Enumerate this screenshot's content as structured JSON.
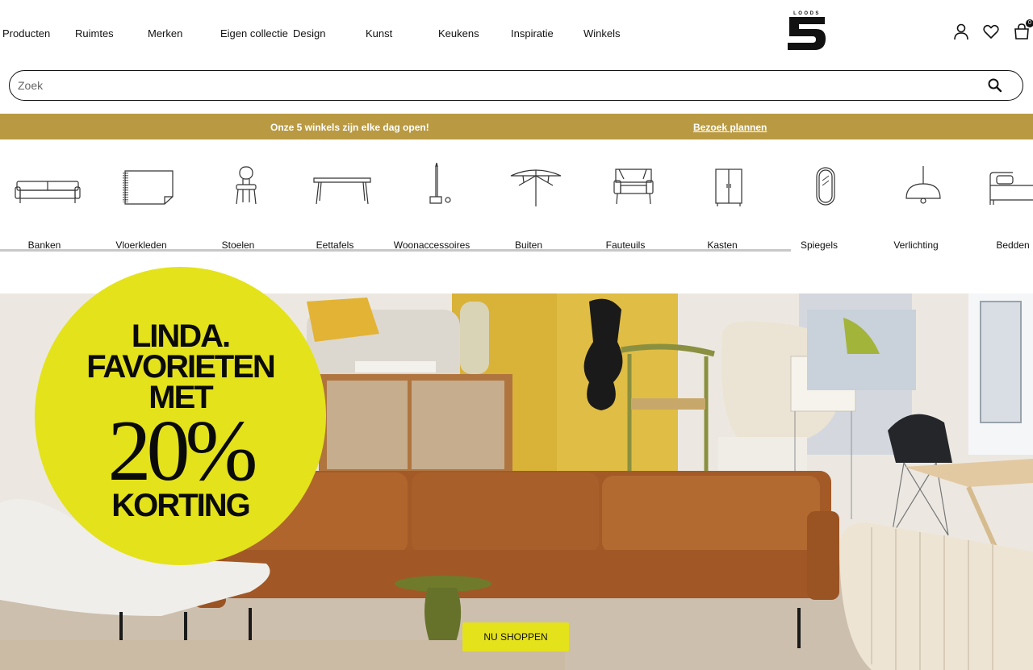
{
  "nav": {
    "items": [
      "Producten",
      "Ruimtes",
      "Merken",
      "Eigen collectie",
      "Design",
      "Kunst",
      "Keukens",
      "Inspiratie",
      "Winkels"
    ]
  },
  "brand": {
    "logo_text": "LOODS",
    "logo_number": "5"
  },
  "header_icons": {
    "account": "user-icon",
    "wishlist": "heart-icon",
    "cart": "bag-icon",
    "cart_count": "0"
  },
  "search": {
    "placeholder": "Zoek",
    "value": ""
  },
  "announcement": {
    "text": "Onze 5 winkels zijn elke dag open!",
    "link": "Bezoek plannen",
    "bg_color": "#b99a43"
  },
  "categories": [
    {
      "label": "Banken",
      "icon": "sofa-icon"
    },
    {
      "label": "Vloerkleden",
      "icon": "rug-icon"
    },
    {
      "label": "Stoelen",
      "icon": "chair-icon"
    },
    {
      "label": "Eettafels",
      "icon": "table-icon"
    },
    {
      "label": "Woonaccessoires",
      "icon": "candle-icon"
    },
    {
      "label": "Buiten",
      "icon": "parasol-icon"
    },
    {
      "label": "Fauteuils",
      "icon": "armchair-icon"
    },
    {
      "label": "Kasten",
      "icon": "cabinet-icon"
    },
    {
      "label": "Spiegels",
      "icon": "mirror-icon"
    },
    {
      "label": "Verlichting",
      "icon": "lamp-icon"
    },
    {
      "label": "Bedden",
      "icon": "bed-icon"
    }
  ],
  "hero": {
    "promo_lines": [
      "LINDA.",
      "FAVORIETEN",
      "MET"
    ],
    "promo_percent": "20%",
    "promo_last": "KORTING",
    "cta": "NU SHOPPEN",
    "accent_color": "#e4e21b"
  }
}
